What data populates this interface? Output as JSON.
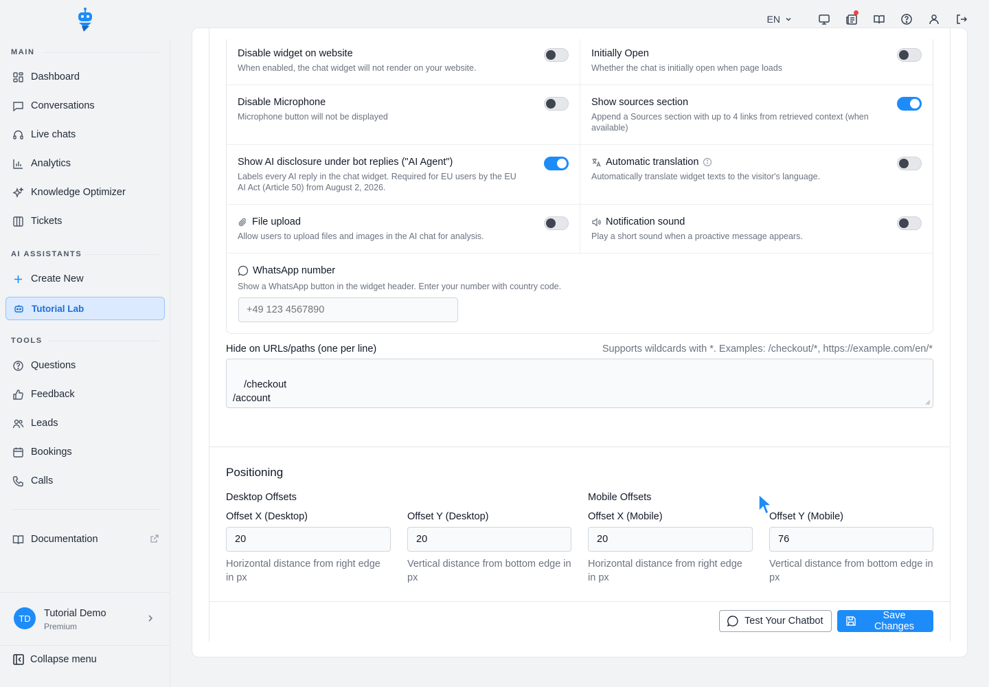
{
  "header": {
    "language": "EN",
    "icons": [
      "monitor-icon",
      "news-icon",
      "book-icon",
      "help-icon",
      "user-icon",
      "logout-icon"
    ]
  },
  "sidebar": {
    "sections": {
      "main": "MAIN",
      "assistants": "AI ASSISTANTS",
      "tools": "TOOLS"
    },
    "main_items": [
      {
        "label": "Dashboard",
        "icon": "dashboard-icon"
      },
      {
        "label": "Conversations",
        "icon": "chat-icon"
      },
      {
        "label": "Live chats",
        "icon": "headset-icon"
      },
      {
        "label": "Analytics",
        "icon": "bar-chart-icon"
      },
      {
        "label": "Knowledge Optimizer",
        "icon": "sparkles-icon"
      },
      {
        "label": "Tickets",
        "icon": "columns-icon"
      }
    ],
    "assistant_items": [
      {
        "label": "Create New",
        "icon": "plus-icon"
      },
      {
        "label": "Tutorial Lab",
        "icon": "bot-icon",
        "active": true
      }
    ],
    "tool_items": [
      {
        "label": "Questions",
        "icon": "question-icon"
      },
      {
        "label": "Feedback",
        "icon": "thumbs-up-icon"
      },
      {
        "label": "Leads",
        "icon": "users-icon"
      },
      {
        "label": "Bookings",
        "icon": "calendar-icon"
      },
      {
        "label": "Calls",
        "icon": "phone-icon"
      }
    ],
    "documentation": "Documentation",
    "user": {
      "initials": "TD",
      "name": "Tutorial Demo",
      "plan": "Premium"
    },
    "collapse": "Collapse menu"
  },
  "settings": {
    "disable_widget": {
      "title": "Disable widget on website",
      "desc": "When enabled, the chat widget will not render on your website.",
      "on": false
    },
    "initially_open": {
      "title": "Initially Open",
      "desc": "Whether the chat is initially open when page loads",
      "on": false
    },
    "disable_mic": {
      "title": "Disable Microphone",
      "desc": "Microphone button will not be displayed",
      "on": false
    },
    "show_sources": {
      "title": "Show sources section",
      "desc": "Append a Sources section with up to 4 links from retrieved context (when available)",
      "on": true
    },
    "ai_disclosure": {
      "title": "Show AI disclosure under bot replies (\"AI Agent\")",
      "desc": "Labels every AI reply in the chat widget. Required for EU users by the EU AI Act (Article 50) from August 2, 2026.",
      "on": true
    },
    "auto_translate": {
      "title": "Automatic translation",
      "desc": "Automatically translate widget texts to the visitor's language.",
      "on": false
    },
    "file_upload": {
      "title": "File upload",
      "desc": "Allow users to upload files and images in the AI chat for analysis.",
      "on": false
    },
    "notif_sound": {
      "title": "Notification sound",
      "desc": "Play a short sound when a proactive message appears.",
      "on": false
    },
    "whatsapp": {
      "title": "WhatsApp number",
      "desc": "Show a WhatsApp button in the widget header. Enter your number with country code.",
      "placeholder": "+49 123 4567890",
      "value": ""
    }
  },
  "hide_urls": {
    "label": "Hide on URLs/paths (one per line)",
    "hint": "Supports wildcards with *. Examples: /checkout/*, https://example.com/en/*",
    "value": "/checkout\n/account"
  },
  "positioning": {
    "title": "Positioning",
    "desktop_label": "Desktop Offsets",
    "mobile_label": "Mobile Offsets",
    "fields": [
      {
        "label": "Offset X (Desktop)",
        "value": "20",
        "help": "Horizontal distance from right edge in px"
      },
      {
        "label": "Offset Y (Desktop)",
        "value": "20",
        "help": "Vertical distance from bottom edge in px"
      },
      {
        "label": "Offset X (Mobile)",
        "value": "20",
        "help": "Horizontal distance from right edge in px"
      },
      {
        "label": "Offset Y (Mobile)",
        "value": "76",
        "help": "Vertical distance from bottom edge in px"
      }
    ]
  },
  "actions": {
    "test": "Test Your Chatbot",
    "save": "Save Changes"
  },
  "colors": {
    "accent": "#1d8cf8",
    "active_bg": "#dbeafe",
    "notification": "#ef4444"
  }
}
